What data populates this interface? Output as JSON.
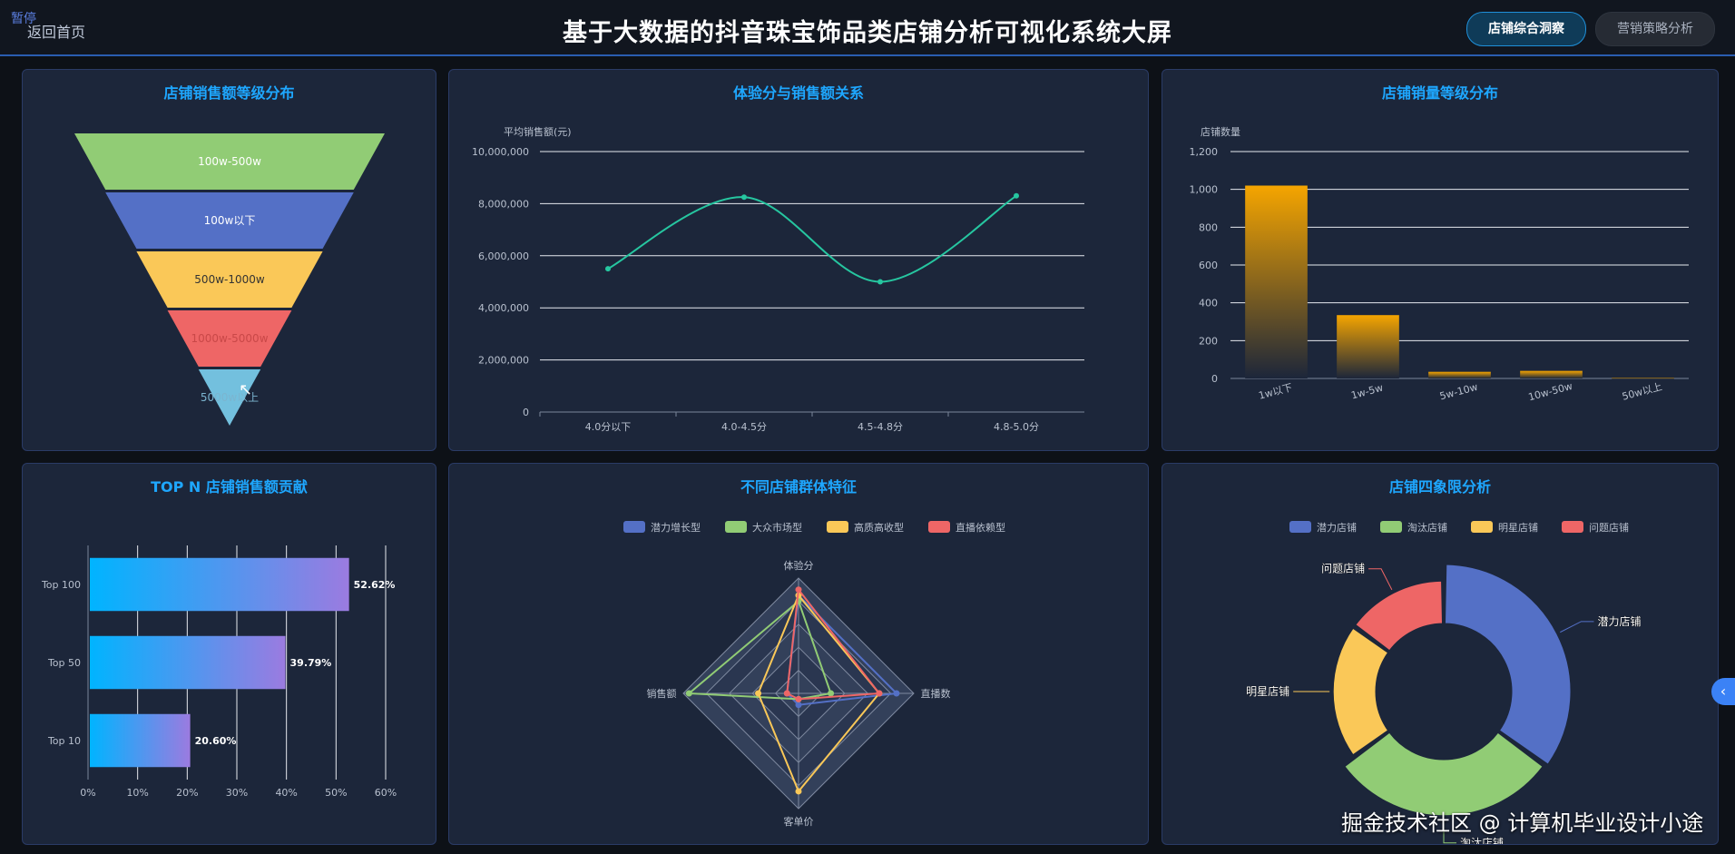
{
  "header": {
    "pause": "暂停",
    "back": "返回首页",
    "title": "基于大数据的抖音珠宝饰品类店铺分析可视化系统大屏",
    "tabs": [
      {
        "label": "店铺综合洞察",
        "active": true
      },
      {
        "label": "营销策略分析",
        "active": false
      }
    ],
    "edge_icon": "chevron-left-icon"
  },
  "panels": {
    "funnel": "店铺销售额等级分布",
    "line": "体验分与销售额关系",
    "bar": "店铺销量等级分布",
    "hbar": "TOP N 店铺销售额贡献",
    "radar": "不同店铺群体特征",
    "pie": "店铺四象限分析"
  },
  "watermark": "掘金技术社区 @ 计算机毕业设计小途",
  "colors": {
    "accent": "#1ea7ff",
    "bg": "#0d1117",
    "panel": "#1c263a"
  },
  "chart_data": [
    {
      "type": "funnel",
      "title": "店铺销售额等级分布",
      "categories": [
        "100w-500w",
        "100w以下",
        "500w-1000w",
        "1000w-5000w",
        "5000w以上"
      ],
      "values": [
        100,
        80,
        60,
        40,
        20
      ],
      "colors": [
        "#91cc75",
        "#5470c6",
        "#fac858",
        "#ee6666",
        "#73c0de"
      ]
    },
    {
      "type": "line",
      "title": "体验分与销售额关系",
      "ylabel": "平均销售额(元)",
      "categories": [
        "4.0分以下",
        "4.0-4.5分",
        "4.5-4.8分",
        "4.8-5.0分"
      ],
      "values": [
        5500000,
        8250000,
        5000000,
        8300000
      ],
      "ylim": [
        0,
        10000000
      ],
      "yticks": [
        "0",
        "2,000,000",
        "4,000,000",
        "6,000,000",
        "8,000,000",
        "10,000,000"
      ],
      "color": "#26c6a0"
    },
    {
      "type": "bar",
      "title": "店铺销量等级分布",
      "ylabel": "店铺数量",
      "categories": [
        "1w以下",
        "1w-5w",
        "5w-10w",
        "10w-50w",
        "50w以上"
      ],
      "values": [
        1020,
        335,
        35,
        40,
        3
      ],
      "ylim": [
        0,
        1200
      ],
      "yticks": [
        "0",
        "200",
        "400",
        "600",
        "800",
        "1,000",
        "1,200"
      ],
      "color": "#f5a500"
    },
    {
      "type": "bar",
      "orientation": "horizontal",
      "title": "TOP N 店铺销售额贡献",
      "categories": [
        "Top 100",
        "Top 50",
        "Top 10"
      ],
      "values": [
        52.62,
        39.79,
        20.6
      ],
      "value_labels": [
        "52.62%",
        "39.79%",
        "20.60%"
      ],
      "xlim": [
        0,
        60
      ],
      "xticks": [
        "0%",
        "10%",
        "20%",
        "30%",
        "40%",
        "50%",
        "60%"
      ]
    },
    {
      "type": "radar",
      "title": "不同店铺群体特征",
      "indicators": [
        "体验分",
        "直播数",
        "客单价",
        "销售额"
      ],
      "series": [
        {
          "name": "潜力增长型",
          "color": "#5470c6",
          "values": [
            0.85,
            0.85,
            0.1,
            0.1
          ]
        },
        {
          "name": "大众市场型",
          "color": "#91cc75",
          "values": [
            0.8,
            0.28,
            0.05,
            0.95
          ]
        },
        {
          "name": "高质高收型",
          "color": "#fac858",
          "values": [
            0.85,
            0.7,
            0.85,
            0.35
          ]
        },
        {
          "name": "直播依赖型",
          "color": "#ee6666",
          "values": [
            0.9,
            0.7,
            0.05,
            0.1
          ]
        }
      ]
    },
    {
      "type": "pie",
      "style": "rose-donut",
      "title": "店铺四象限分析",
      "categories": [
        "潜力店铺",
        "淘汰店铺",
        "明星店铺",
        "问题店铺"
      ],
      "values": [
        35,
        30,
        20,
        15
      ],
      "radii": [
        1.0,
        0.95,
        0.72,
        0.72
      ],
      "colors": [
        "#5470c6",
        "#91cc75",
        "#fac858",
        "#ee6666"
      ]
    }
  ]
}
